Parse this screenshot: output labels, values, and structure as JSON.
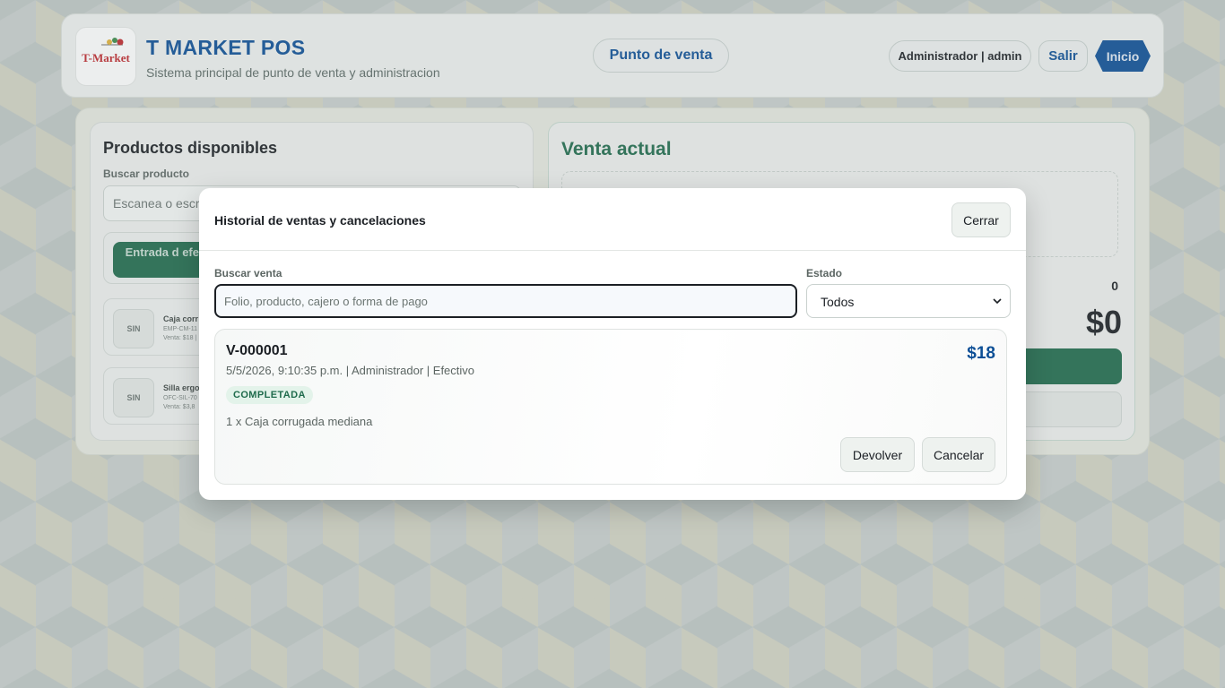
{
  "header": {
    "logo_text": "T-Market",
    "app_title": "T MARKET POS",
    "app_subtitle": "Sistema principal de punto de venta y administracion",
    "mode_label": "Punto de venta",
    "user_label": "Administrador | admin",
    "logout_label": "Salir",
    "home_label": "Inicio"
  },
  "products_panel": {
    "title": "Productos disponibles",
    "search_label": "Buscar producto",
    "search_placeholder": "Escanea o escri",
    "cash_button_label": "Entrada d efectivo",
    "items": [
      {
        "thumb": "SIN",
        "name": "Caja corr",
        "sku": "EMP-CM-11",
        "price": "Venta: $18 |"
      },
      {
        "thumb": "SIN",
        "name": "Silla ergo",
        "sku": "OFC-SIL-70",
        "price": "Venta: $3,8"
      }
    ]
  },
  "sale_panel": {
    "title": "Venta actual",
    "item_count": "0",
    "total": "$0"
  },
  "modal": {
    "title": "Historial de ventas y cancelaciones",
    "close_label": "Cerrar",
    "search_label": "Buscar venta",
    "search_placeholder": "Folio, producto, cajero o forma de pago",
    "status_label": "Estado",
    "status_selected": "Todos",
    "sales": [
      {
        "folio": "V-000001",
        "meta": "5/5/2026, 9:10:35 p.m. | Administrador | Efectivo",
        "amount": "$18",
        "status": "COMPLETADA",
        "items": "1 x Caja corrugada mediana",
        "return_label": "Devolver",
        "cancel_label": "Cancelar"
      }
    ]
  },
  "colors": {
    "brand_blue": "#0d4f96",
    "brand_green": "#1f6b4c",
    "logo_red": "#c0282d",
    "badge_bg": "#e3f3ea"
  },
  "icons": {
    "select_arrow": "chevron-down-icon"
  }
}
